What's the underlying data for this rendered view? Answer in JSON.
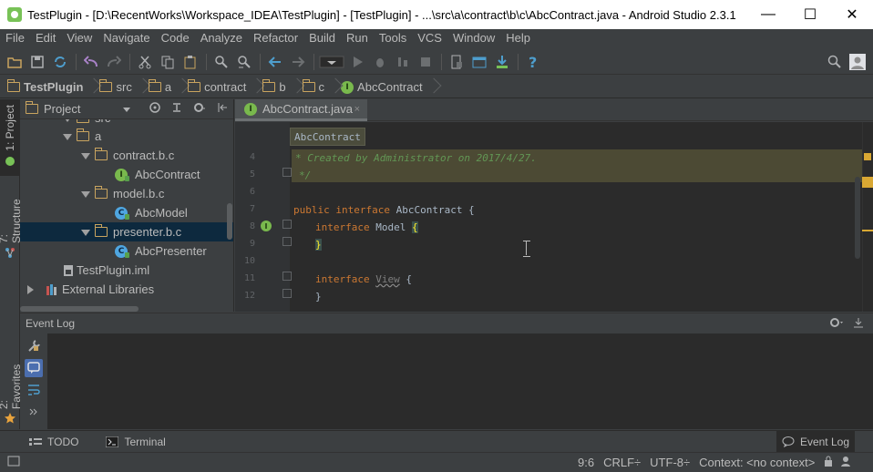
{
  "window": {
    "title": "TestPlugin - [D:\\RecentWorks\\Workspace_IDEA\\TestPlugin] - [TestPlugin] - ...\\src\\a\\contract\\b\\c\\AbcContract.java - Android Studio 2.3.1",
    "controls": {
      "minimize": "—",
      "maximize": "☐",
      "close": "✕"
    }
  },
  "menu": [
    "File",
    "Edit",
    "View",
    "Navigate",
    "Code",
    "Analyze",
    "Refactor",
    "Build",
    "Run",
    "Tools",
    "VCS",
    "Window",
    "Help"
  ],
  "breadcrumb": [
    "TestPlugin",
    "src",
    "a",
    "contract",
    "b",
    "c",
    "AbcContract"
  ],
  "left_strip": {
    "project": "1: Project",
    "structure": "7: Structure",
    "favorites": "2: Favorites"
  },
  "project_panel": {
    "header": "Project",
    "tree": [
      {
        "label": "src",
        "type": "folder",
        "expanded": true
      },
      {
        "label": "a",
        "type": "folder",
        "expanded": true
      },
      {
        "label": "contract.b.c",
        "type": "folder",
        "expanded": true
      },
      {
        "label": "AbcContract",
        "type": "interface"
      },
      {
        "label": "model.b.c",
        "type": "folder",
        "expanded": true
      },
      {
        "label": "AbcModel",
        "type": "class"
      },
      {
        "label": "presenter.b.c",
        "type": "folder",
        "expanded": true,
        "selected": true
      },
      {
        "label": "AbcPresenter",
        "type": "class"
      },
      {
        "label": "TestPlugin.iml",
        "type": "file"
      },
      {
        "label": "External Libraries",
        "type": "library",
        "expanded": false
      }
    ]
  },
  "editor": {
    "tab_label": "AbcContract.java",
    "tab_close": "×",
    "structure_popup": "AbcContract",
    "lines": [
      {
        "num": "4",
        "text": "* Created by Administrator on 2017/4/27."
      },
      {
        "num": "5",
        "text": "*/"
      },
      {
        "num": "6",
        "text": ""
      },
      {
        "num": "7",
        "kw": "public interface",
        "name": " AbcContract {"
      },
      {
        "num": "8",
        "kw": "interface",
        "name": " Model ",
        "brace": "{"
      },
      {
        "num": "9",
        "brace": "}"
      },
      {
        "num": "10",
        "text": ""
      },
      {
        "num": "11",
        "kw": "interface",
        "name": " ",
        "ident": "View",
        "tail": " {"
      },
      {
        "num": "12",
        "text": "}"
      }
    ]
  },
  "event_log": {
    "title": "Event Log"
  },
  "bottom_tabs": [
    "TODO",
    "Terminal",
    "Event Log"
  ],
  "status": {
    "position": "9:6",
    "line_sep": "CRLF÷",
    "encoding": "UTF-8÷",
    "context": "Context: <no context>"
  },
  "colors": {
    "bg": "#3c3f41",
    "editor_bg": "#2b2b2b",
    "keyword": "#cc7832",
    "comment": "#629755",
    "selection": "#0d293e"
  }
}
